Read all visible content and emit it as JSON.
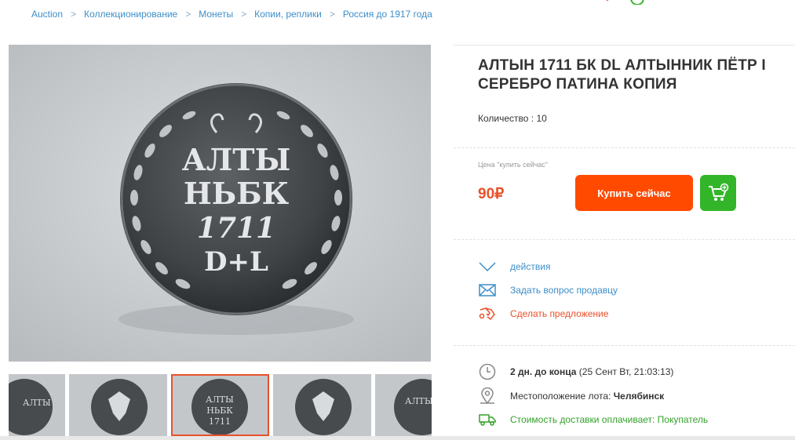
{
  "breadcrumb": {
    "items": [
      "Auction",
      "Коллекционирование",
      "Монеты",
      "Копии, реплики",
      "Россия до 1917 года"
    ],
    "separator": ">"
  },
  "lot": {
    "title": "АЛТЫН 1711 БК DL АЛТЫННИК ПЁТР I СЕРЕБРО ПАТИНА КОПИЯ",
    "quantity_label": "Количество : 10"
  },
  "purchase": {
    "price_label": "Цена \"купить сейчас\"",
    "price": "90₽",
    "buy_label": "Купить сейчас",
    "cart_icon": "cart-add-icon"
  },
  "actions": {
    "items": [
      {
        "label": "действия",
        "icon": "chevron-down-icon"
      },
      {
        "label": "Задать вопрос продавцу",
        "icon": "envelope-icon"
      },
      {
        "label": "Сделать предложение",
        "icon": "offer-hand-icon"
      }
    ]
  },
  "info": {
    "time_left": "2 дн. до конца",
    "end_date": "(25 Сент Вт, 21:03:13)",
    "location_label": "Местоположение лота:",
    "location_value": "Челябинск",
    "delivery": "Стоимость доставки оплачивает: Покупатель"
  },
  "coin": {
    "line1": "АЛТЫ",
    "line2": "НЬБК",
    "line3": "1711",
    "line4": "D+L"
  },
  "colors": {
    "link": "#3d8ec9",
    "accent": "#ff4a00",
    "price": "#e8512a",
    "cart": "#33b52a",
    "delivery": "#33a12a"
  }
}
